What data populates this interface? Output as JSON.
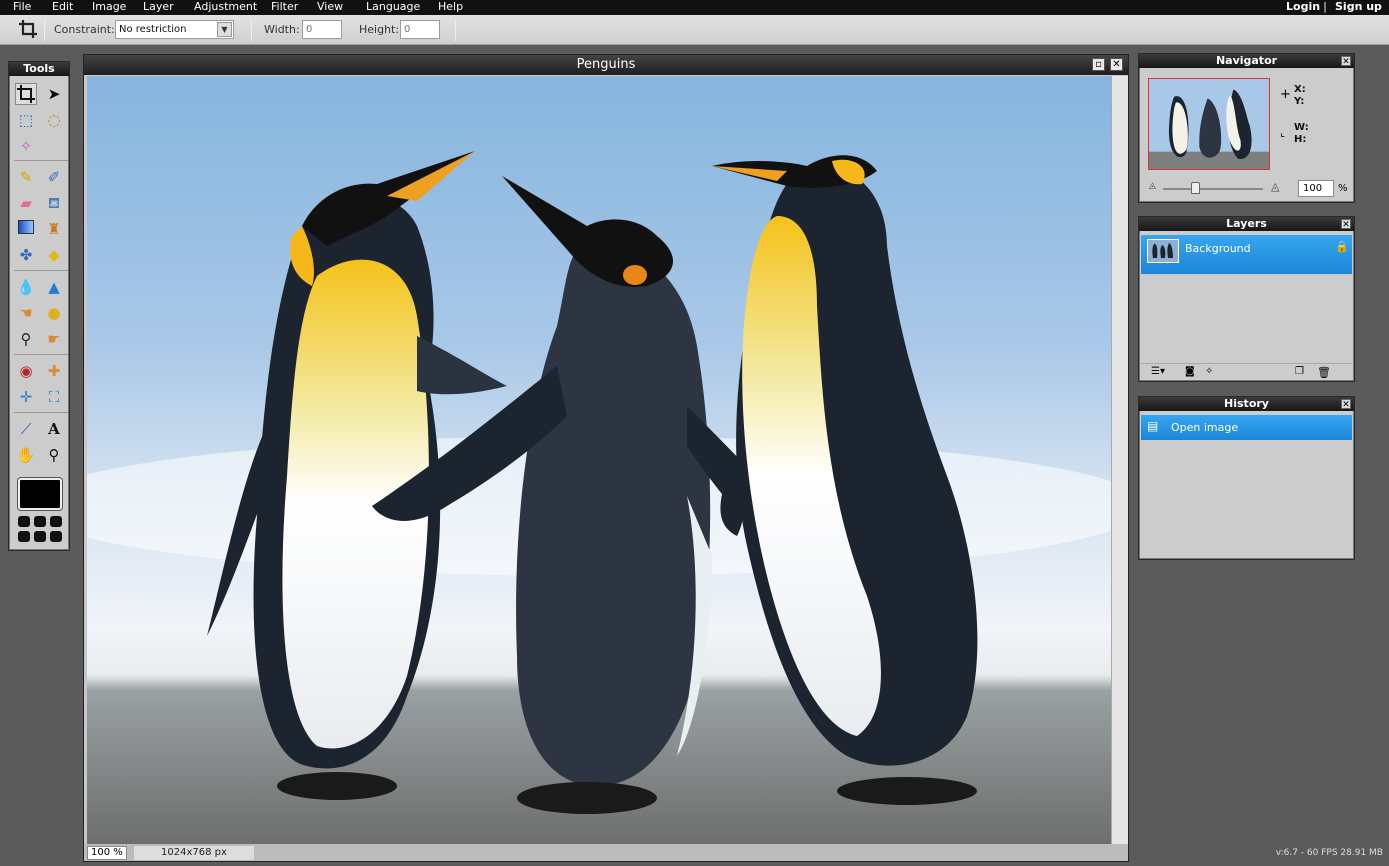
{
  "menu": {
    "items": [
      "File",
      "Edit",
      "Image",
      "Layer",
      "Adjustment",
      "Filter",
      "View",
      "Language",
      "Help"
    ],
    "login": "Login",
    "divider": "|",
    "signup": "Sign up"
  },
  "toolbar": {
    "active_tool_icon": "crop-icon",
    "constraint_label": "Constraint:",
    "constraint_value": "No restriction",
    "width_label": "Width:",
    "width_value": "0",
    "height_label": "Height:",
    "height_value": "0"
  },
  "tools_panel": {
    "title": "Tools",
    "tools": [
      "crop",
      "move",
      "marquee",
      "lasso",
      "magic-wand",
      "pencil",
      "brush",
      "eraser",
      "bucket",
      "gradient",
      "stamp",
      "color-replace",
      "shapes",
      "blur",
      "sharpen",
      "smudge",
      "sponge",
      "dodge",
      "burn",
      "red-eye",
      "spot-heal",
      "bloat",
      "pinch",
      "color-picker",
      "type",
      "hand",
      "zoom"
    ],
    "foreground_color": "#000000"
  },
  "document": {
    "title": "Penguins",
    "zoom": "100 %",
    "dimensions": "1024x768 px"
  },
  "navigator": {
    "title": "Navigator",
    "x_label": "X:",
    "y_label": "Y:",
    "w_label": "W:",
    "h_label": "H:",
    "zoom_value": "100",
    "zoom_unit": "%",
    "zoom_slider_level": 0.32
  },
  "layers": {
    "title": "Layers",
    "items": [
      {
        "name": "Background",
        "locked": true
      }
    ]
  },
  "history": {
    "title": "History",
    "items": [
      "Open image"
    ]
  },
  "footer": {
    "version": "v:6.7 - 60 FPS 28.91 MB"
  },
  "colors": {
    "menubar": "#111111",
    "selection": "#2596e4",
    "panel": "#cccccc"
  }
}
